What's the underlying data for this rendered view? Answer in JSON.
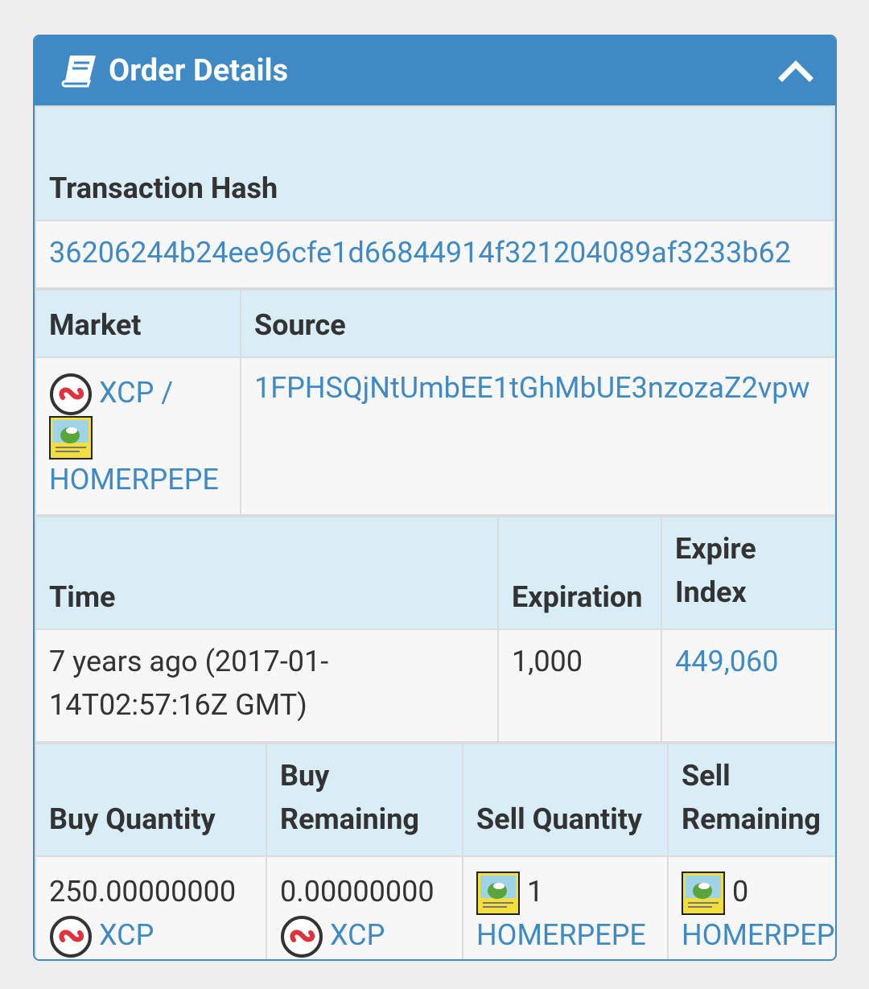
{
  "panel": {
    "title": "Order Details"
  },
  "tx": {
    "header": "Transaction Hash",
    "hash": "36206244b24ee96cfe1d66844914f321204089af3233b62"
  },
  "market": {
    "header_market": "Market",
    "header_source": "Source",
    "base": "XCP /",
    "quote": "HOMERPEPE",
    "source": "1FPHSQjNtUmbEE1tGhMbUE3nzozaZ2vpw"
  },
  "time": {
    "header_time": "Time",
    "header_expiration": "Expiration",
    "header_expire_index": "Expire Index",
    "value": "7 years ago (2017-01-14T02:57:16Z GMT)",
    "expiration": "1,000",
    "expire_index": "449,060"
  },
  "quantities": {
    "header_buy_qty": "Buy Quantity",
    "header_buy_rem": "Buy Remaining",
    "header_sell_qty": "Sell Quantity",
    "header_sell_rem": "Sell Remaining",
    "buy_qty": "250.00000000",
    "buy_qty_asset": "XCP",
    "buy_rem": "0.00000000",
    "buy_rem_asset": "XCP",
    "sell_qty": "1",
    "sell_qty_asset": "HOMERPEPE",
    "sell_rem": "0",
    "sell_rem_asset": "HOMERPEPE"
  },
  "colors": {
    "header_bg": "#3f8ac5",
    "th_bg": "#d9edf7",
    "link": "#3f8ac5",
    "xcp_red": "#e0323c"
  },
  "icons": {
    "header": "book-icon",
    "collapse": "chevron-up-icon",
    "xcp": "xcp-token-icon",
    "pepe": "homerpepe-card-icon"
  }
}
